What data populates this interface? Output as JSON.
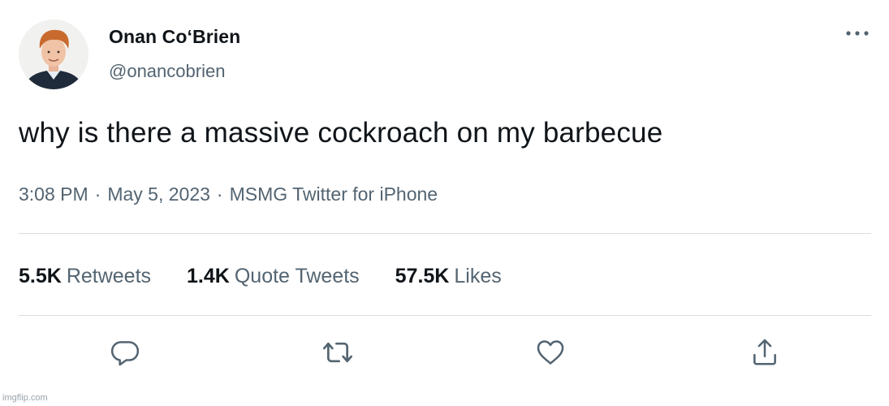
{
  "author": {
    "display_name": "Onan Co‘Brien",
    "handle": "@onancobrien",
    "avatar_icon": "profile-photo"
  },
  "more_icon": "more-dots-icon",
  "tweet": {
    "text": "why is there a massive cockroach on my barbecue"
  },
  "meta": {
    "time": "3:08 PM",
    "separator": "·",
    "date": "May 5, 2023",
    "source": "MSMG Twitter for iPhone"
  },
  "stats": {
    "retweets": {
      "value": "5.5K",
      "label": "Retweets"
    },
    "quotes": {
      "value": "1.4K",
      "label": "Quote Tweets"
    },
    "likes": {
      "value": "57.5K",
      "label": "Likes"
    }
  },
  "actions": [
    {
      "name": "reply",
      "icon": "reply-icon"
    },
    {
      "name": "retweet",
      "icon": "retweet-icon"
    },
    {
      "name": "like",
      "icon": "heart-icon"
    },
    {
      "name": "share",
      "icon": "share-icon"
    }
  ],
  "colors": {
    "text": "#0f1419",
    "secondary": "#536471",
    "divider": "#d8dde1"
  },
  "watermark": "imgflip.com"
}
